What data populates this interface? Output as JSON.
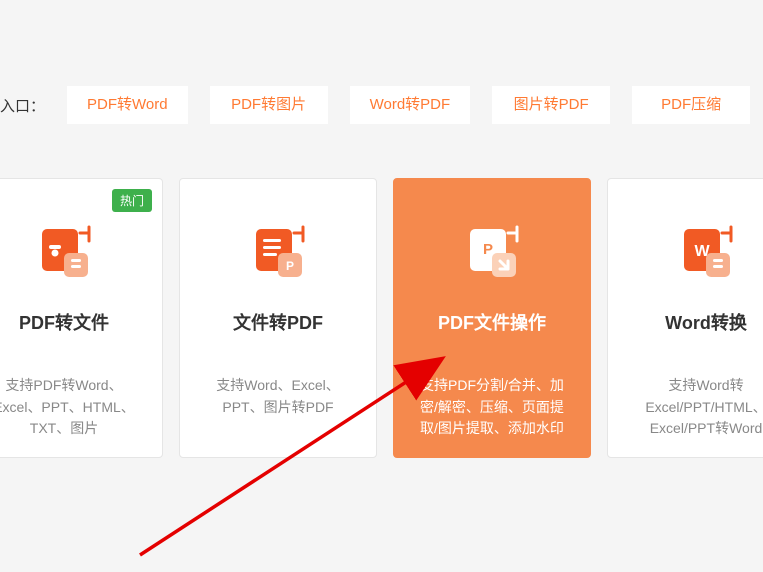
{
  "entry_label": "入口：",
  "tabs": [
    "PDF转Word",
    "PDF转图片",
    "Word转PDF",
    "图片转PDF",
    "PDF压缩"
  ],
  "cards": [
    {
      "title": "PDF转文件",
      "desc": "支持PDF转Word、Excel、PPT、HTML、TXT、图片",
      "badge": "热门"
    },
    {
      "title": "文件转PDF",
      "desc": "支持Word、Excel、PPT、图片转PDF"
    },
    {
      "title": "PDF文件操作",
      "desc": "支持PDF分割/合并、加密/解密、压缩、页面提取/图片提取、添加水印"
    },
    {
      "title": "Word转换",
      "desc": "支持Word转Excel/PPT/HTML、Excel/PPT转Word"
    }
  ]
}
